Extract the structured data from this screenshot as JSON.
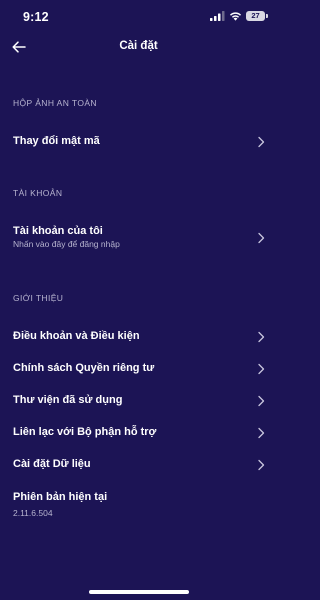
{
  "status_bar": {
    "time": "9:12",
    "battery": "27",
    "icons": [
      "signal-icon",
      "wifi-icon",
      "battery-icon"
    ]
  },
  "nav": {
    "title": "Cài đặt",
    "back_icon": "arrow-left-icon"
  },
  "sections": {
    "safe_box": {
      "header": "HỘP ẢNH AN TOÀN",
      "change_passcode": "Thay đổi mật mã"
    },
    "account": {
      "header": "TÀI KHOẢN",
      "my_account": "Tài khoản của tôi",
      "my_account_sub": "Nhấn vào đây để đăng nhập"
    },
    "about": {
      "header": "GIỚI THIỆU",
      "terms": "Điều khoản và Điều kiện",
      "privacy": "Chính sách Quyền riêng tư",
      "libraries": "Thư viện đã sử dụng",
      "support": "Liên lạc với Bộ phận hỗ trợ",
      "data_settings": "Cài đặt Dữ liệu",
      "version_label": "Phiên bản hiện tại",
      "version_value": "2.11.6.504"
    }
  },
  "theme": {
    "background": "#1c1455",
    "text": "#ffffff",
    "muted": "#b7b4cf"
  }
}
